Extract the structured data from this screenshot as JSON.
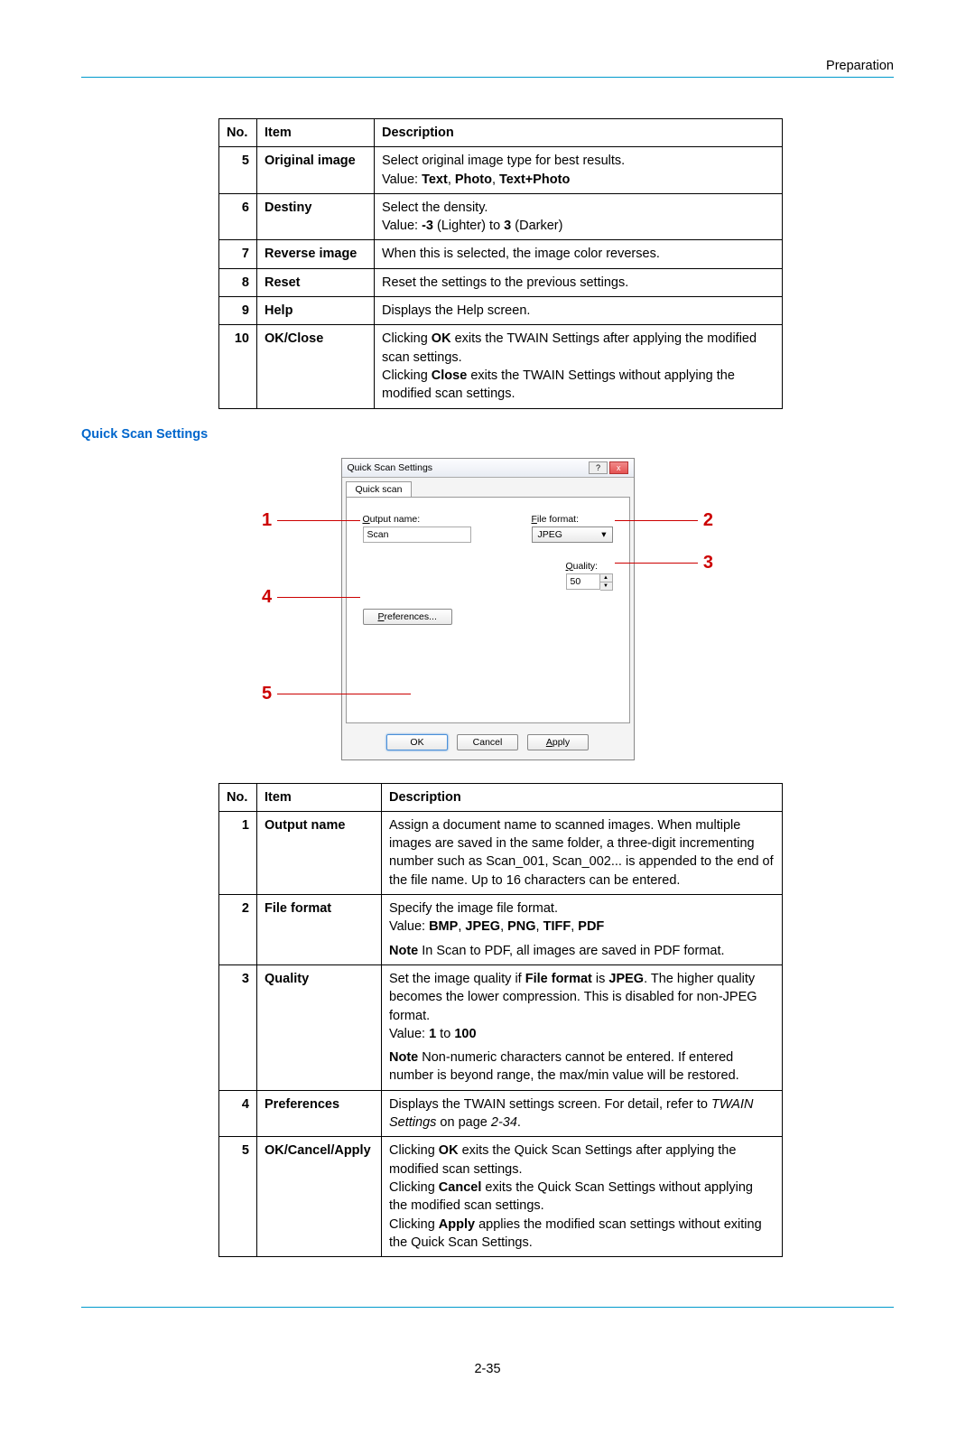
{
  "header": {
    "section": "Preparation"
  },
  "table1": {
    "headers": {
      "no": "No.",
      "item": "Item",
      "desc": "Description"
    },
    "rows": [
      {
        "no": "5",
        "item": "Original image",
        "desc_line1": "Select original image type for best results.",
        "desc_value_prefix": "Value: ",
        "desc_value_bold": "Text",
        "desc_comma1": ", ",
        "desc_value_bold2": "Photo",
        "desc_comma2": ", ",
        "desc_value_bold3": "Text+Photo"
      },
      {
        "no": "6",
        "item": "Destiny",
        "desc_line1": "Select the density.",
        "desc_value_prefix": "Value: ",
        "desc_value_bold": "-3",
        "desc_mid": " (Lighter) to ",
        "desc_value_bold2": "3",
        "desc_suffix": " (Darker)"
      },
      {
        "no": "7",
        "item": "Reverse image",
        "desc": "When this is selected, the image color reverses."
      },
      {
        "no": "8",
        "item": "Reset",
        "desc": "Reset the settings to the previous settings."
      },
      {
        "no": "9",
        "item": "Help",
        "desc": "Displays the Help screen."
      },
      {
        "no": "10",
        "item": "OK/Close",
        "desc_pre1": "Clicking ",
        "desc_b1": "OK",
        "desc_post1": " exits the TWAIN Settings after applying the modified scan settings.",
        "desc_pre2": "Clicking ",
        "desc_b2": "Close",
        "desc_post2": " exits the TWAIN Settings without applying the modified scan settings."
      }
    ]
  },
  "quick_scan_title": "Quick Scan Settings",
  "dialog": {
    "title": "Quick Scan Settings",
    "tab": "Quick scan",
    "output_label": "Output name:",
    "output_value": "Scan",
    "format_label": "File format:",
    "format_value": "JPEG",
    "quality_label": "Quality:",
    "quality_value": "50",
    "pref_btn": "Preferences...",
    "ok": "OK",
    "cancel": "Cancel",
    "apply": "Apply",
    "help_btn": "?",
    "close_btn": "x"
  },
  "callouts": {
    "c1": "1",
    "c2": "2",
    "c3": "3",
    "c4": "4",
    "c5": "5"
  },
  "table2": {
    "headers": {
      "no": "No.",
      "item": "Item",
      "desc": "Description"
    },
    "r1": {
      "no": "1",
      "item": "Output name",
      "desc": "Assign a document name to scanned images. When multiple images are saved in the same folder, a three-digit incrementing number such as Scan_001, Scan_002... is appended to the end of the file name. Up to 16 characters can be entered."
    },
    "r2": {
      "no": "2",
      "item": "File format",
      "line1": "Specify the image file format.",
      "value_prefix": "Value: ",
      "v1": "BMP",
      "c1": ", ",
      "v2": "JPEG",
      "c2": ", ",
      "v3": "PNG",
      "c3": ", ",
      "v4": "TIFF",
      "c4": ", ",
      "v5": "PDF",
      "note_b": "Note",
      "note": "  In Scan to PDF, all images are saved in PDF format."
    },
    "r3": {
      "no": "3",
      "item": "Quality",
      "pre1": "Set the image quality if ",
      "b1": "File format",
      "mid1": " is ",
      "b2": "JPEG",
      "post1": ". The higher quality becomes the lower compression. This is disabled for non-JPEG format.",
      "value_prefix": "Value: ",
      "vb1": "1",
      "vmid": " to ",
      "vb2": "100",
      "note_b": "Note",
      "note": "  Non-numeric characters cannot be entered. If entered number is beyond range, the max/min value will be restored."
    },
    "r4": {
      "no": "4",
      "item": "Preferences",
      "pre": "Displays the TWAIN settings screen. For detail, refer to ",
      "i1": "TWAIN Settings",
      "mid": " on page ",
      "i2": "2-34",
      "suffix": "."
    },
    "r5": {
      "no": "5",
      "item": "OK/Cancel/Apply",
      "pre1": "Clicking ",
      "b1": "OK",
      "post1": " exits the Quick Scan Settings after applying the modified scan settings.",
      "pre2": "Clicking ",
      "b2": "Cancel",
      "post2": " exits the Quick Scan Settings without applying the modified scan settings.",
      "pre3": "Clicking ",
      "b3": "Apply",
      "post3": " applies the modified scan settings without exiting the Quick Scan Settings."
    }
  },
  "footer": "2-35"
}
